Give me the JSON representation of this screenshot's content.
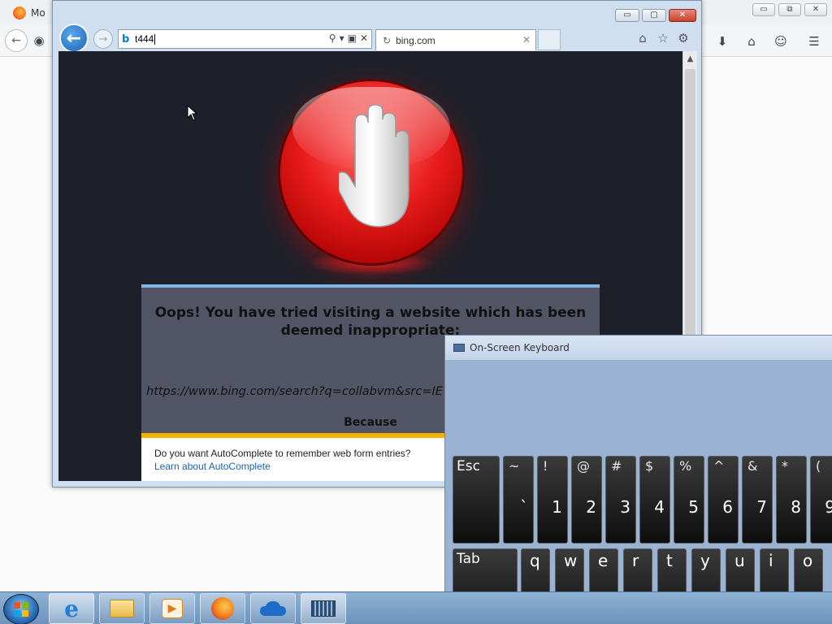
{
  "firefox": {
    "tab_title": "Mo",
    "caption_minimize": "▭",
    "caption_maximize": "⧉",
    "caption_close": "✕"
  },
  "ie": {
    "address_text": "t444",
    "tab_title": "bing.com",
    "tab_close": "✕",
    "caption_minimize": "▭",
    "caption_maximize": "▢",
    "caption_close": "✕"
  },
  "page": {
    "warning_title": "Oops! You have tried visiting a website which has been deemed inappropriate:",
    "blocked_url": "https://www.bing.com/search?q=collabvm&src=IE",
    "because": "Because"
  },
  "autocomplete": {
    "question": "Do you want AutoComplete to remember web form entries?",
    "link": "Learn about AutoComplete"
  },
  "osk": {
    "title": "On-Screen Keyboard",
    "row1": [
      {
        "label": "Esc"
      },
      {
        "top": "~",
        "main": "`"
      },
      {
        "top": "!",
        "main": "1"
      },
      {
        "top": "@",
        "main": "2"
      },
      {
        "top": "#",
        "main": "3"
      },
      {
        "top": "$",
        "main": "4"
      },
      {
        "top": "%",
        "main": "5"
      },
      {
        "top": "^",
        "main": "6"
      },
      {
        "top": "&",
        "main": "7"
      },
      {
        "top": "*",
        "main": "8"
      },
      {
        "top": "(",
        "main": "9"
      }
    ],
    "row2": [
      {
        "label": "Tab"
      },
      {
        "letter": "q"
      },
      {
        "letter": "w"
      },
      {
        "letter": "e"
      },
      {
        "letter": "r"
      },
      {
        "letter": "t"
      },
      {
        "letter": "y"
      },
      {
        "letter": "u"
      },
      {
        "letter": "i"
      },
      {
        "letter": "o"
      }
    ]
  },
  "taskbar": {
    "items": [
      "internet-explorer",
      "file-explorer",
      "media-player",
      "firefox",
      "onedrive",
      "on-screen-keyboard"
    ]
  }
}
